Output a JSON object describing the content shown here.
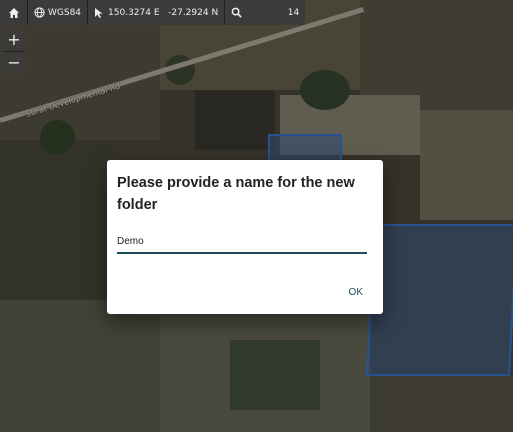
{
  "toolbar": {
    "home_icon": "home-icon",
    "crs_label": "WGS84",
    "crs_icon": "globe-icon",
    "pointer_icon": "pointer-icon",
    "coordinates": "150.3274 E   -27.2924 N",
    "zoom_icon": "magnifier-icon",
    "zoom_level": "14"
  },
  "zoom_controls": {
    "zoom_in_label": "+",
    "zoom_out_label": "−"
  },
  "map": {
    "road_label": "Surat Developmental Rd",
    "parcel_color": "#3a7bd5"
  },
  "dialog": {
    "title": "Please provide a name for the new folder",
    "input_value": "Demo",
    "ok_label": "OK",
    "accent_color": "#1f4a57"
  }
}
